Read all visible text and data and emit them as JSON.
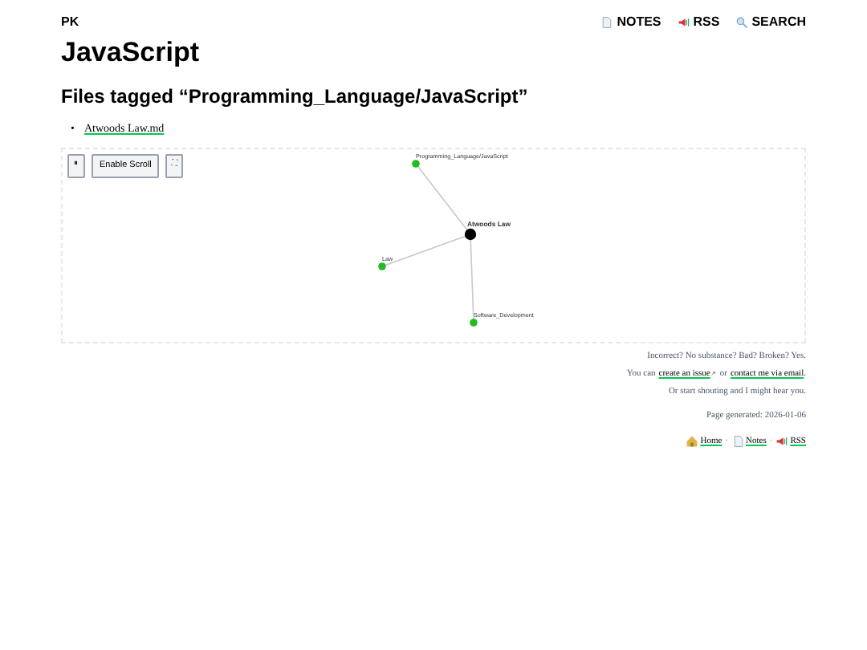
{
  "site": {
    "logo": "PK",
    "nav": [
      {
        "kind": "notes",
        "label": "NOTES"
      },
      {
        "kind": "rss",
        "label": "RSS"
      },
      {
        "kind": "search",
        "label": "SEARCH"
      }
    ]
  },
  "title": "JavaScript",
  "heading": "Files tagged “Programming_Language/JavaScript”",
  "files": [
    {
      "bullet": "•",
      "name": "Atwoods Law.md"
    }
  ],
  "graph": {
    "controls": [
      {
        "kind": "pause",
        "label": "⏸"
      },
      {
        "kind": "text",
        "label": "Enable Scroll"
      },
      {
        "kind": "fullscreen",
        "label": "⛶"
      }
    ],
    "nodes": [
      {
        "kind": "tag",
        "label": "Programming_Language/JavaScript"
      },
      {
        "kind": "note",
        "label": "Atwoods Law"
      },
      {
        "kind": "tag",
        "label": "Law"
      },
      {
        "kind": "tag",
        "label": "Software_Development"
      }
    ]
  },
  "footer": {
    "line1": "Incorrect? No substance? Bad? Broken? Yes.",
    "you_can": "You can",
    "issue_link": "create an issue",
    "or": "or",
    "email_link": "contact me via email",
    "period": ".",
    "line3": "Or start shouting and I might hear you.",
    "generated": "Page generated: 2026-01-06",
    "links": [
      {
        "kind": "home",
        "label": "Home"
      },
      {
        "kind": "notes",
        "label": "Notes"
      },
      {
        "kind": "rss",
        "label": "RSS"
      }
    ],
    "separator": "·"
  }
}
